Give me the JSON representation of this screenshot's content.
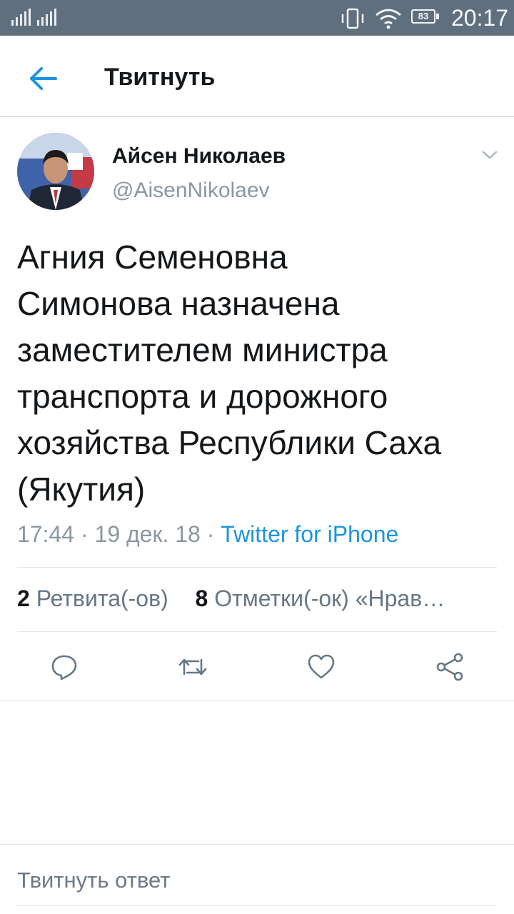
{
  "status_bar": {
    "time": "20:17",
    "battery": "83",
    "icons": [
      "signal-icon",
      "vibrate-icon",
      "wifi-icon",
      "battery-icon"
    ]
  },
  "header": {
    "title": "Твитнуть",
    "back_icon": "arrow-left-icon"
  },
  "tweet": {
    "author_name": "Айсен Николаев",
    "author_handle": "@AisenNikolaev",
    "text": "Агния Семеновна\nСимонова назначена\nзаместителем министра\nтранспорта и дорожного\nхозяйства Республики Саха\n(Якутия)",
    "time": "17:44",
    "date": "19 дек. 18",
    "separator": " · ",
    "source": "Twitter for iPhone",
    "stats": {
      "retweets_count": "2",
      "retweets_label": "Ретвита(-ов)",
      "likes_count": "8",
      "likes_label": "Отметки(-ок) «Нрав…"
    }
  },
  "actions": [
    "reply-icon",
    "retweet-icon",
    "like-icon",
    "share-icon"
  ],
  "reply": {
    "placeholder": "Твитнуть ответ"
  },
  "colors": {
    "status_bar": "#5f6f7d",
    "accent": "#1b95e0",
    "text": "#14171a",
    "secondary_text": "#8a97a3",
    "divider": "#e1e6ea"
  }
}
